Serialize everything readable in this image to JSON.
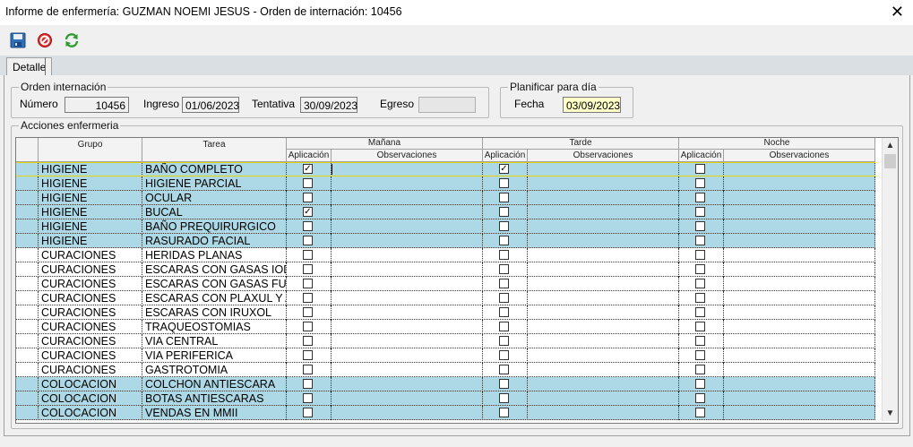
{
  "window": {
    "title": "Informe de enfermería: GUZMAN NOEMI JESUS - Orden de internación: 10456",
    "close_glyph": "✕"
  },
  "toolbar": {
    "save_icon": "floppy-disk-icon",
    "cancel_icon": "no-entry-icon",
    "refresh_icon": "refresh-arrows-icon"
  },
  "tabs": [
    {
      "label": "Detalle"
    }
  ],
  "orden": {
    "legend": "Orden internación",
    "numero_label": "Número",
    "numero": "10456",
    "ingreso_label": "Ingreso",
    "ingreso": "01/06/2023",
    "tentativa_label": "Tentativa",
    "tentativa": "30/09/2023",
    "egreso_label": "Egreso",
    "egreso": ""
  },
  "planificar": {
    "legend": "Planificar para día",
    "fecha_label": "Fecha",
    "fecha": "03/09/2023"
  },
  "acciones": {
    "legend": "Acciones enfermeria",
    "headers": {
      "grupo": "Grupo",
      "tarea": "Tarea",
      "manana": "Mañana",
      "tarde": "Tarde",
      "noche": "Noche",
      "aplicacion": "Aplicación",
      "observaciones": "Observaciones"
    },
    "rows": [
      {
        "grupo": "HIGIENE",
        "tarea": "BAÑO COMPLETO",
        "m": true,
        "t": true,
        "n": false,
        "hl": true
      },
      {
        "grupo": "HIGIENE",
        "tarea": "HIGIENE PARCIAL",
        "m": false,
        "t": false,
        "n": false,
        "hl": true
      },
      {
        "grupo": "HIGIENE",
        "tarea": "OCULAR",
        "m": false,
        "t": false,
        "n": false,
        "hl": true
      },
      {
        "grupo": "HIGIENE",
        "tarea": "BUCAL",
        "m": true,
        "t": false,
        "n": false,
        "hl": true
      },
      {
        "grupo": "HIGIENE",
        "tarea": "BAÑO PREQUIRURGICO",
        "m": false,
        "t": false,
        "n": false,
        "hl": true
      },
      {
        "grupo": "HIGIENE",
        "tarea": "RASURADO FACIAL",
        "m": false,
        "t": false,
        "n": false,
        "hl": true
      },
      {
        "grupo": "CURACIONES",
        "tarea": "HERIDAS PLANAS",
        "m": false,
        "t": false,
        "n": false,
        "hl": false
      },
      {
        "grupo": "CURACIONES",
        "tarea": "ESCARAS CON GASAS IODO",
        "m": false,
        "t": false,
        "n": false,
        "hl": false
      },
      {
        "grupo": "CURACIONES",
        "tarea": "ESCARAS CON GASAS FURA",
        "m": false,
        "t": false,
        "n": false,
        "hl": false
      },
      {
        "grupo": "CURACIONES",
        "tarea": "ESCARAS CON PLAXUL Y AZ",
        "m": false,
        "t": false,
        "n": false,
        "hl": false
      },
      {
        "grupo": "CURACIONES",
        "tarea": "ESCARAS CON IRUXOL",
        "m": false,
        "t": false,
        "n": false,
        "hl": false
      },
      {
        "grupo": "CURACIONES",
        "tarea": "TRAQUEOSTOMIAS",
        "m": false,
        "t": false,
        "n": false,
        "hl": false
      },
      {
        "grupo": "CURACIONES",
        "tarea": "VIA CENTRAL",
        "m": false,
        "t": false,
        "n": false,
        "hl": false
      },
      {
        "grupo": "CURACIONES",
        "tarea": "VIA PERIFERICA",
        "m": false,
        "t": false,
        "n": false,
        "hl": false
      },
      {
        "grupo": "CURACIONES",
        "tarea": "GASTROTOMIA",
        "m": false,
        "t": false,
        "n": false,
        "hl": false
      },
      {
        "grupo": "COLOCACION",
        "tarea": "COLCHON ANTIESCARA",
        "m": false,
        "t": false,
        "n": false,
        "hl": true
      },
      {
        "grupo": "COLOCACION",
        "tarea": "BOTAS ANTIESCARAS",
        "m": false,
        "t": false,
        "n": false,
        "hl": true
      },
      {
        "grupo": "COLOCACION",
        "tarea": "VENDAS EN MMII",
        "m": false,
        "t": false,
        "n": false,
        "hl": true
      }
    ]
  },
  "colors": {
    "highlight_row": "#add8e6",
    "selected_row_border": "#e6d400",
    "date_field_bg": "#ffffc8"
  }
}
